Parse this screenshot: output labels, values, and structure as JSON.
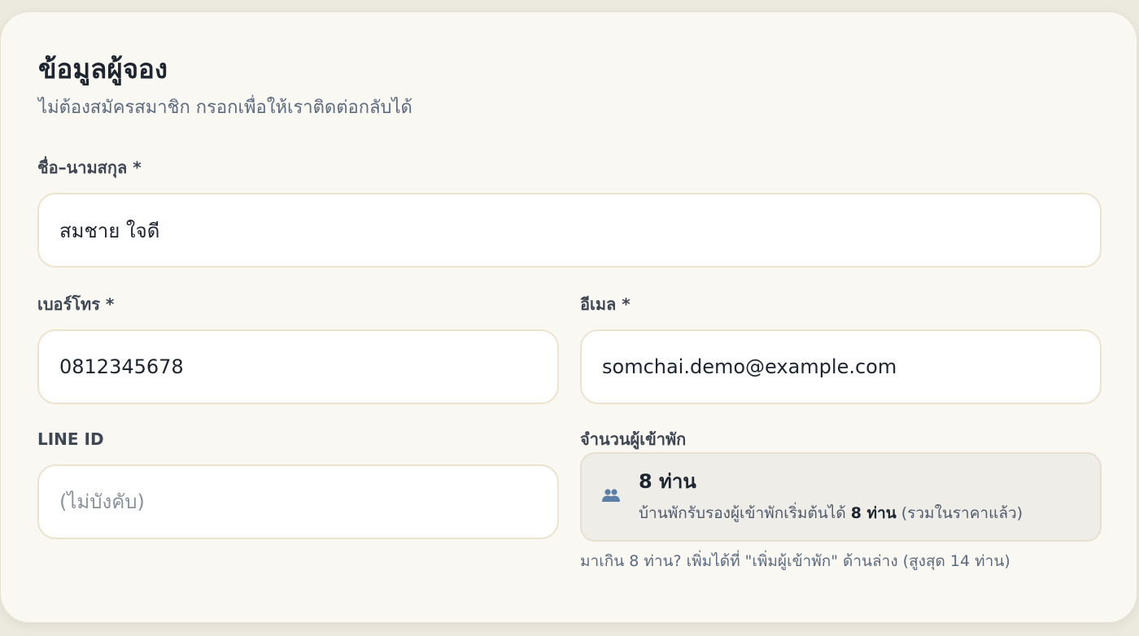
{
  "section": {
    "title": "ข้อมูลผู้จอง",
    "subtitle": "ไม่ต้องสมัครสมาชิก กรอกเพื่อให้เราติดต่อกลับได้"
  },
  "fields": {
    "full_name": {
      "label": "ชื่อ–นามสกุล *",
      "value": "สมชาย ใจดี"
    },
    "phone": {
      "label": "เบอร์โทร *",
      "value": "0812345678"
    },
    "email": {
      "label": "อีเมล *",
      "value": "somchai.demo@example.com"
    },
    "line_id": {
      "label": "LINE ID",
      "value": "",
      "placeholder": "(ไม่บังคับ)"
    }
  },
  "guests": {
    "label": "จำนวนผู้เข้าพัก",
    "count": "8 ท่าน",
    "icon": "people-icon",
    "note_prefix": "บ้านพักรับรองผู้เข้าพักเริ่มต้นได้ ",
    "note_bold": "8 ท่าน",
    "note_suffix": " (รวมในราคาแล้ว)",
    "hint": "มาเกิน 8 ท่าน? เพิ่มได้ที่ \"เพิ่มผู้เข้าพัก\" ด้านล่าง (สูงสุด 14 ท่าน)"
  },
  "colors": {
    "card_background": "#faf8f2",
    "input_border": "#ece3cf",
    "icon_blue": "#5b7fa6"
  }
}
